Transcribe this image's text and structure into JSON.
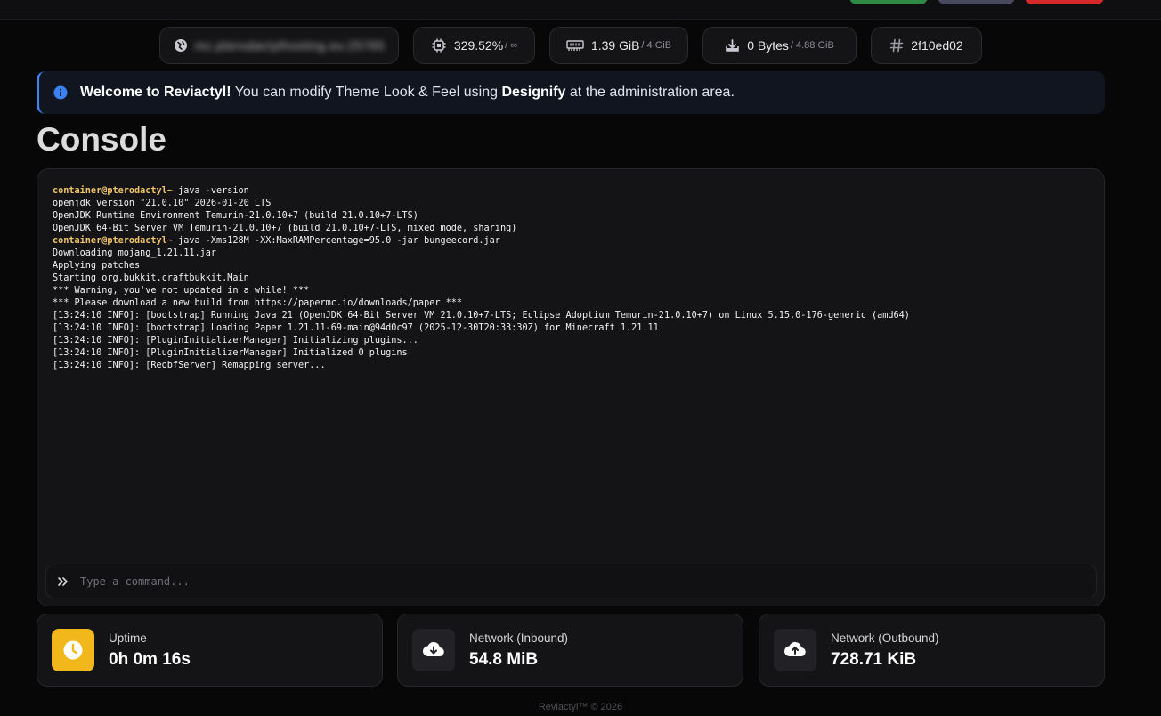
{
  "power_buttons": {
    "start": "",
    "restart": "",
    "stop": ""
  },
  "stats_bar": {
    "address": "mc.pterodactylhosting.eu:25765",
    "cpu": {
      "value": "329.52%",
      "limit": "/ ∞"
    },
    "memory": {
      "value": "1.39 GiB",
      "limit": "/ 4 GiB"
    },
    "disk": {
      "value": "0 Bytes",
      "limit": "/ 4.88 GiB"
    },
    "server_id": "2f10ed02"
  },
  "alert": {
    "strong": "Welcome to Reviactyl!",
    "text_1": " You can modify Theme Look & Feel using ",
    "link": "Designify",
    "text_2": " at the administration area."
  },
  "page_title": "Console",
  "console": {
    "lines": [
      {
        "prompt": "container@pterodactyl~",
        "text": " java -version"
      },
      {
        "text": "openjdk version \"21.0.10\" 2026-01-20 LTS"
      },
      {
        "text": "OpenJDK Runtime Environment Temurin-21.0.10+7 (build 21.0.10+7-LTS)"
      },
      {
        "text": "OpenJDK 64-Bit Server VM Temurin-21.0.10+7 (build 21.0.10+7-LTS, mixed mode, sharing)"
      },
      {
        "prompt": "container@pterodactyl~",
        "text": " java -Xms128M -XX:MaxRAMPercentage=95.0 -jar bungeecord.jar"
      },
      {
        "text": "Downloading mojang_1.21.11.jar"
      },
      {
        "text": "Applying patches"
      },
      {
        "text": "Starting org.bukkit.craftbukkit.Main"
      },
      {
        "text": "*** Warning, you've not updated in a while! ***"
      },
      {
        "text": "*** Please download a new build from https://papermc.io/downloads/paper ***"
      },
      {
        "text": "[13:24:10 INFO]: [bootstrap] Running Java 21 (OpenJDK 64-Bit Server VM 21.0.10+7-LTS; Eclipse Adoptium Temurin-21.0.10+7) on Linux 5.15.0-176-generic (amd64)"
      },
      {
        "text": "[13:24:10 INFO]: [bootstrap] Loading Paper 1.21.11-69-main@94d0c97 (2025-12-30T20:33:30Z) for Minecraft 1.21.11"
      },
      {
        "text": "[13:24:10 INFO]: [PluginInitializerManager] Initializing plugins..."
      },
      {
        "text": "[13:24:10 INFO]: [PluginInitializerManager] Initialized 0 plugins"
      },
      {
        "text": "[13:24:10 INFO]: [ReobfServer] Remapping server..."
      }
    ],
    "command_placeholder": "Type a command..."
  },
  "stats": {
    "uptime": {
      "label": "Uptime",
      "value": "0h 0m 16s"
    },
    "network_in": {
      "label": "Network (Inbound)",
      "value": "54.8 MiB"
    },
    "network_out": {
      "label": "Network (Outbound)",
      "value": "728.71 KiB"
    }
  },
  "footer": "Reviactyl™ © 2026",
  "icons": {
    "address": "globe-icon",
    "cpu": "cpu-chip-icon",
    "memory": "memory-icon",
    "disk": "disk-download-icon",
    "server_id": "hash-icon",
    "alert": "info-circle-icon",
    "command": "chevrons-right-icon",
    "uptime": "clock-icon",
    "network_in": "cloud-download-icon",
    "network_out": "cloud-upload-icon"
  },
  "colors": {
    "background": "#070708",
    "card": "#141416",
    "accent_blue": "#3b82f6",
    "uptime_yellow": "#f2b71a",
    "prompt_gold": "#f0c46a",
    "start_green": "#2f8a45",
    "restart_gray": "#474a5e",
    "stop_red": "#d4282a"
  }
}
